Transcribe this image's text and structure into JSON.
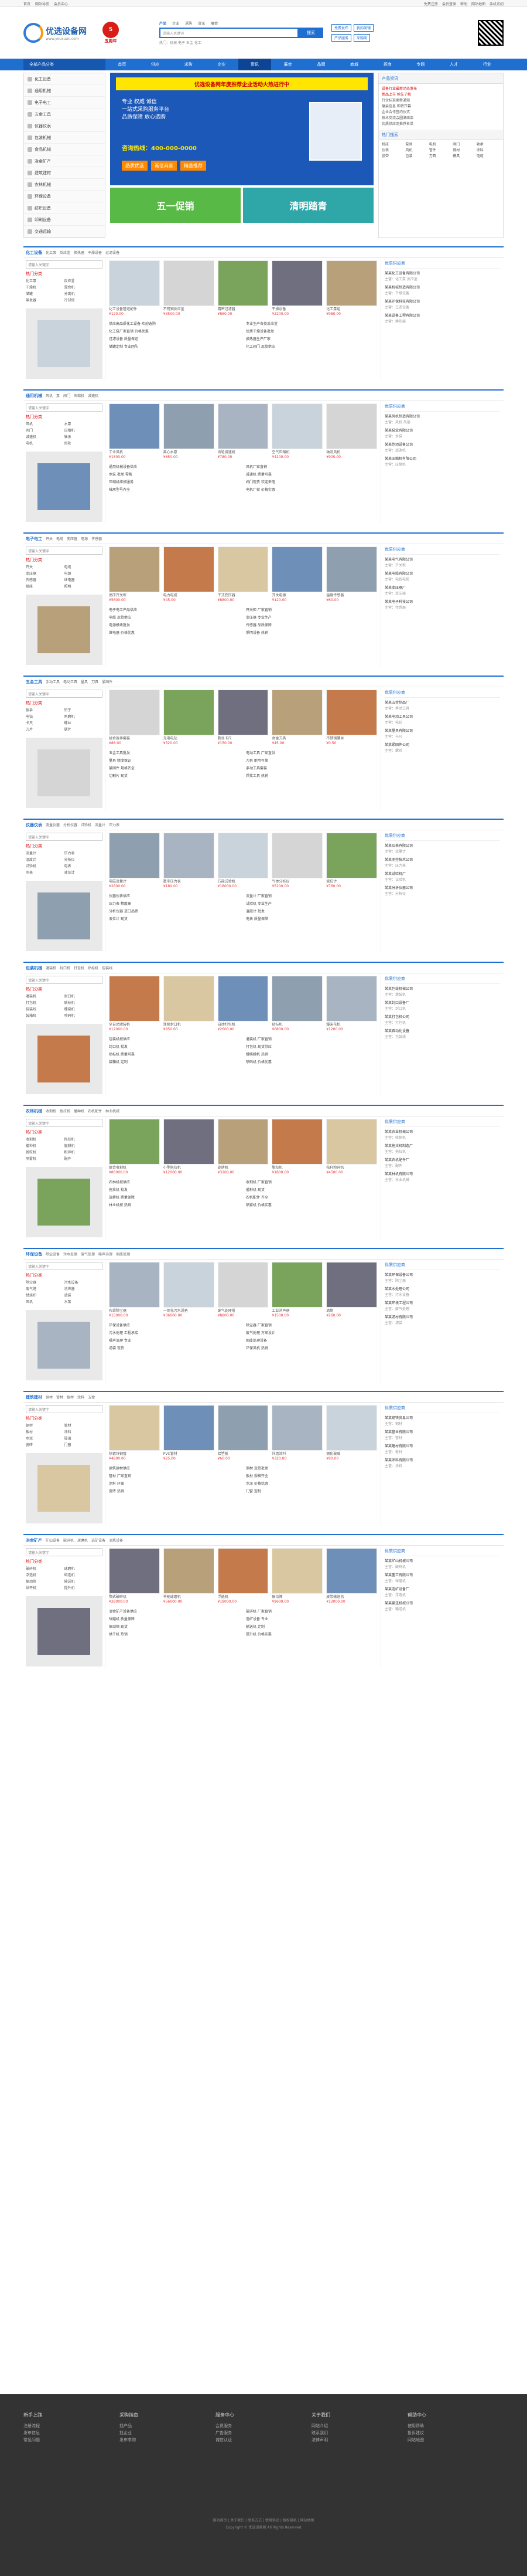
{
  "topbar": {
    "left": [
      "首页",
      "网站导航",
      "会员中心"
    ],
    "right": [
      "免费注册",
      "会员登录",
      "帮助",
      "网站地图",
      "手机访问"
    ]
  },
  "header": {
    "logo_title": "优选设备网",
    "logo_sub": "www.youxuan.com",
    "badge_text": "五周年",
    "search_tabs": [
      "产品",
      "企业",
      "求购",
      "资讯",
      "展会"
    ],
    "search_placeholder": "请输入关键词",
    "search_button": "搜索",
    "hot": "热门：机械 电子 五金 化工",
    "buttons": [
      [
        "免费发布",
        "我的商铺"
      ],
      [
        "产品服务",
        "采购商"
      ]
    ]
  },
  "nav": {
    "category_label": "全部产品分类",
    "items": [
      "首页",
      "供应",
      "求购",
      "企业",
      "资讯",
      "展会",
      "品牌",
      "商城",
      "招商",
      "专题",
      "人才",
      "行业"
    ]
  },
  "categories": [
    "化工设备",
    "通用机械",
    "电子电工",
    "五金工具",
    "仪器仪表",
    "包装机械",
    "食品机械",
    "冶金矿产",
    "建筑建材",
    "农林机械",
    "环保设备",
    "纺织设备",
    "印刷设备",
    "交通运输"
  ],
  "banner": {
    "head": "优选设备网年度推荐企业活动火热进行中",
    "lines": [
      "专业 权威 诚信",
      "一站式采购服务平台",
      "品质保障 放心选购"
    ],
    "phone": "咨询热线：400-000-0000",
    "tags": [
      "品质优选",
      "诚信商家",
      "精品推荐"
    ],
    "sub": [
      "五一促销",
      "清明踏青"
    ]
  },
  "side": {
    "head": "产品资讯",
    "news": [
      "设备行业最新动态发布",
      "新品上市 抢先了解",
      "行业标准更新通知",
      "展会信息 即将开幕",
      "企业合作签约仪式",
      "技术交流会圆满结束",
      "优质供应商推荐名单"
    ],
    "keywords_head": "热门搜索",
    "keywords": [
      "机床",
      "泵阀",
      "电机",
      "阀门",
      "轴承",
      "仪表",
      "风机",
      "管件",
      "钢材",
      "涂料",
      "胶带",
      "包装",
      "刀具",
      "模具",
      "电缆"
    ]
  },
  "sections": [
    {
      "title": "化工设备",
      "subs": [
        "化工泵",
        "反应釜",
        "换热器",
        "干燥设备",
        "过滤设备"
      ],
      "left_select": "请输入关键字",
      "left_title": "热门分类",
      "left_links": [
        "化工泵",
        "反应釜",
        "干燥机",
        "混合机",
        "储罐",
        "分离机",
        "蒸发器",
        "冷却塔"
      ],
      "products": [
        {
          "name": "化工设备管道配件",
          "price": "¥120.00"
        },
        {
          "name": "不锈钢反应釜",
          "price": "¥3500.00"
        },
        {
          "name": "精密过滤器",
          "price": "¥860.00"
        },
        {
          "name": "干燥设备",
          "price": "¥2200.00"
        },
        {
          "name": "化工泵组",
          "price": "¥980.00"
        }
      ],
      "news": [
        "供应高品质化工设备 欢迎选购",
        "专业生产各类反应釜",
        "化工泵厂家直销 价格优惠",
        "优质干燥设备批发",
        "过滤设备 质量保证",
        "换热器生产厂家",
        "储罐定制 专业团队",
        "化工阀门 现货供应"
      ],
      "right_head": "优质供应商",
      "companies": [
        {
          "n": "某某化工设备有限公司",
          "s": "主营：化工泵 反应釜"
        },
        {
          "n": "某某机械制造有限公司",
          "s": "主营：干燥设备"
        },
        {
          "n": "某某环保科技有限公司",
          "s": "主营：过滤设备"
        },
        {
          "n": "某某设备工程有限公司",
          "s": "主营：换热器"
        }
      ]
    },
    {
      "title": "通用机械",
      "subs": [
        "风机",
        "泵",
        "阀门",
        "压缩机",
        "减速机"
      ],
      "left_select": "请输入关键字",
      "left_title": "热门分类",
      "left_links": [
        "风机",
        "水泵",
        "阀门",
        "压缩机",
        "减速机",
        "轴承",
        "电机",
        "齿轮"
      ],
      "products": [
        {
          "name": "工业风机",
          "price": "¥1500.00"
        },
        {
          "name": "离心水泵",
          "price": "¥650.00"
        },
        {
          "name": "齿轮减速机",
          "price": "¥780.00"
        },
        {
          "name": "空气压缩机",
          "price": "¥4200.00"
        },
        {
          "name": "轴流风机",
          "price": "¥900.00"
        }
      ],
      "news": [
        "通用机械设备供应",
        "风机厂家直销",
        "水泵 批发 零售",
        "减速机 质量可靠",
        "压缩机维修服务",
        "阀门现货 欢迎来电",
        "轴承型号齐全",
        "电机厂家 价格实惠"
      ],
      "right_head": "优质供应商",
      "companies": [
        {
          "n": "某某风机制造有限公司",
          "s": "主营：风机 风扇"
        },
        {
          "n": "某某泵业有限公司",
          "s": "主营：水泵"
        },
        {
          "n": "某某传动设备公司",
          "s": "主营：减速机"
        },
        {
          "n": "某某压缩机有限公司",
          "s": "主营：压缩机"
        }
      ]
    },
    {
      "title": "电子电工",
      "subs": [
        "开关",
        "电缆",
        "变压器",
        "电源",
        "传感器"
      ],
      "left_select": "请输入关键字",
      "left_title": "热门分类",
      "left_links": [
        "开关",
        "电缆",
        "变压器",
        "电源",
        "传感器",
        "继电器",
        "插座",
        "照明"
      ],
      "products": [
        {
          "name": "高压开关柜",
          "price": "¥5600.00"
        },
        {
          "name": "电力电缆",
          "price": "¥45.00"
        },
        {
          "name": "干式变压器",
          "price": "¥8800.00"
        },
        {
          "name": "开关电源",
          "price": "¥120.00"
        },
        {
          "name": "温度传感器",
          "price": "¥60.00"
        }
      ],
      "news": [
        "电子电工产品供应",
        "开关柜 厂家直销",
        "电缆 现货供应",
        "变压器 专业生产",
        "电源模块批发",
        "传感器 品质保障",
        "继电器 价格优惠",
        "照明设备 热销"
      ],
      "right_head": "优质供应商",
      "companies": [
        {
          "n": "某某电气有限公司",
          "s": "主营：开关柜"
        },
        {
          "n": "某某电缆有限公司",
          "s": "主营：电线电缆"
        },
        {
          "n": "某某变压器厂",
          "s": "主营：变压器"
        },
        {
          "n": "某某电子科技公司",
          "s": "主营：传感器"
        }
      ]
    },
    {
      "title": "五金工具",
      "subs": [
        "手动工具",
        "电动工具",
        "量具",
        "刀具",
        "紧固件"
      ],
      "left_select": "请输入关键字",
      "left_title": "热门分类",
      "left_links": [
        "扳手",
        "钳子",
        "电钻",
        "角磨机",
        "卡尺",
        "螺丝",
        "刀片",
        "锯片"
      ],
      "products": [
        {
          "name": "组合扳手套装",
          "price": "¥88.00"
        },
        {
          "name": "充电电钻",
          "price": "¥320.00"
        },
        {
          "name": "数显卡尺",
          "price": "¥150.00"
        },
        {
          "name": "合金刀具",
          "price": "¥45.00"
        },
        {
          "name": "不锈钢螺丝",
          "price": "¥0.50"
        }
      ],
      "news": [
        "五金工具批发",
        "电动工具 厂家直供",
        "量具 精度保证",
        "刀具 耐用可靠",
        "紧固件 规格齐全",
        "手动工具套装",
        "切割片 现货",
        "焊接工具 热销"
      ],
      "right_head": "优质供应商",
      "companies": [
        {
          "n": "某某五金制品厂",
          "s": "主营：手动工具"
        },
        {
          "n": "某某电动工具公司",
          "s": "主营：电钻"
        },
        {
          "n": "某某量具有限公司",
          "s": "主营：卡尺"
        },
        {
          "n": "某某紧固件公司",
          "s": "主营：螺丝"
        }
      ]
    },
    {
      "title": "仪器仪表",
      "subs": [
        "测量仪器",
        "分析仪器",
        "试验机",
        "流量计",
        "压力表"
      ],
      "left_select": "请输入关键字",
      "left_title": "热门分类",
      "left_links": [
        "流量计",
        "压力表",
        "温度计",
        "分析仪",
        "试验机",
        "电表",
        "水表",
        "液位计"
      ],
      "products": [
        {
          "name": "电磁流量计",
          "price": "¥2600.00"
        },
        {
          "name": "数字压力表",
          "price": "¥180.00"
        },
        {
          "name": "万能试验机",
          "price": "¥18000.00"
        },
        {
          "name": "气体分析仪",
          "price": "¥5200.00"
        },
        {
          "name": "液位计",
          "price": "¥760.00"
        }
      ],
      "news": [
        "仪器仪表供应",
        "流量计 厂家直销",
        "压力表 精度高",
        "试验机 专业生产",
        "分析仪器 进口品质",
        "温度计 批发",
        "液位计 现货",
        "电表 质量保障"
      ],
      "right_head": "优质供应商",
      "companies": [
        {
          "n": "某某仪表有限公司",
          "s": "主营：流量计"
        },
        {
          "n": "某某测控技术公司",
          "s": "主营：压力表"
        },
        {
          "n": "某某试验机厂",
          "s": "主营：试验机"
        },
        {
          "n": "某某分析仪器公司",
          "s": "主营：分析仪"
        }
      ]
    },
    {
      "title": "包装机械",
      "subs": [
        "灌装机",
        "封口机",
        "打包机",
        "贴标机",
        "包装线"
      ],
      "left_select": "请输入关键字",
      "left_title": "热门分类",
      "left_links": [
        "灌装机",
        "封口机",
        "打包机",
        "贴标机",
        "包装线",
        "缠绕机",
        "装箱机",
        "喷码机"
      ],
      "products": [
        {
          "name": "全自动灌装机",
          "price": "¥12000.00"
        },
        {
          "name": "连续封口机",
          "price": "¥850.00"
        },
        {
          "name": "自动打包机",
          "price": "¥2600.00"
        },
        {
          "name": "贴标机",
          "price": "¥6800.00"
        },
        {
          "name": "爆米花机",
          "price": "¥1200.00"
        }
      ],
      "news": [
        "包装机械供应",
        "灌装机 厂家直销",
        "封口机 批发",
        "打包机 现货供应",
        "贴标机 质量可靠",
        "缠绕膜机 热销",
        "装箱机 定制",
        "喷码机 价格优惠"
      ],
      "right_head": "优质供应商",
      "companies": [
        {
          "n": "某某包装机械公司",
          "s": "主营：灌装机"
        },
        {
          "n": "某某封口设备厂",
          "s": "主营：封口机"
        },
        {
          "n": "某某打包机公司",
          "s": "主营：打包机"
        },
        {
          "n": "某某自动化设备",
          "s": "主营：包装线"
        }
      ]
    },
    {
      "title": "农林机械",
      "subs": [
        "收割机",
        "拖拉机",
        "播种机",
        "农机配件",
        "林业机械"
      ],
      "left_select": "请输入关键字",
      "left_title": "热门分类",
      "left_links": [
        "收割机",
        "拖拉机",
        "播种机",
        "旋耕机",
        "脱粒机",
        "粉碎机",
        "喷雾机",
        "配件"
      ],
      "products": [
        {
          "name": "联合收割机",
          "price": "¥86000.00"
        },
        {
          "name": "小型拖拉机",
          "price": "¥12000.00"
        },
        {
          "name": "旋耕机",
          "price": "¥3200.00"
        },
        {
          "name": "脱粒机",
          "price": "¥1800.00"
        },
        {
          "name": "秸秆粉碎机",
          "price": "¥4500.00"
        }
      ],
      "news": [
        "农林机械供应",
        "收割机 厂家直销",
        "拖拉机 批发",
        "播种机 现货",
        "旋耕机 质量保障",
        "农机配件 齐全",
        "林业机械 热销",
        "喷雾机 价格实惠"
      ],
      "right_head": "优质供应商",
      "companies": [
        {
          "n": "某某农业机械公司",
          "s": "主营：收割机"
        },
        {
          "n": "某某拖拉机制造厂",
          "s": "主营：拖拉机"
        },
        {
          "n": "某某农机配件厂",
          "s": "主营：配件"
        },
        {
          "n": "某某林机有限公司",
          "s": "主营：林业机械"
        }
      ]
    },
    {
      "title": "环保设备",
      "subs": [
        "除尘设备",
        "污水处理",
        "废气处理",
        "噪声治理",
        "固废处理"
      ],
      "left_select": "请输入关键字",
      "left_title": "热门分类",
      "left_links": [
        "除尘器",
        "污水设备",
        "废气塔",
        "消声器",
        "焚烧炉",
        "滤袋",
        "风机",
        "水泵"
      ],
      "products": [
        {
          "name": "布袋除尘器",
          "price": "¥15000.00"
        },
        {
          "name": "一体化污水设备",
          "price": "¥36000.00"
        },
        {
          "name": "废气处理塔",
          "price": "¥8800.00"
        },
        {
          "name": "工业消声器",
          "price": "¥1500.00"
        },
        {
          "name": "滤筒",
          "price": "¥260.00"
        }
      ],
      "news": [
        "环保设备供应",
        "除尘器 厂家直销",
        "污水处理 工程承接",
        "废气处理 方案设计",
        "噪声治理 专业",
        "固废处理设备",
        "滤袋 现货",
        "环保风机 热销"
      ],
      "right_head": "优质供应商",
      "companies": [
        {
          "n": "某某环保设备公司",
          "s": "主营：除尘器"
        },
        {
          "n": "某某水处理公司",
          "s": "主营：污水设备"
        },
        {
          "n": "某某环境工程公司",
          "s": "主营：废气处理"
        },
        {
          "n": "某某滤材有限公司",
          "s": "主营：滤袋"
        }
      ]
    },
    {
      "title": "建筑建材",
      "subs": [
        "钢材",
        "管材",
        "板材",
        "涂料",
        "五金"
      ],
      "left_select": "请输入关键字",
      "left_title": "热门分类",
      "left_links": [
        "钢材",
        "管材",
        "板材",
        "涂料",
        "水泥",
        "玻璃",
        "瓷砖",
        "门窗"
      ],
      "products": [
        {
          "name": "热镀锌钢管",
          "price": "¥4800.00"
        },
        {
          "name": "PVC管材",
          "price": "¥25.00"
        },
        {
          "name": "铝塑板",
          "price": "¥60.00"
        },
        {
          "name": "外墙涂料",
          "price": "¥320.00"
        },
        {
          "name": "钢化玻璃",
          "price": "¥90.00"
        }
      ],
      "news": [
        "建筑建材供应",
        "钢材 现货批发",
        "管材 厂家直销",
        "板材 规格齐全",
        "涂料 环保",
        "水泥 价格优惠",
        "瓷砖 热销",
        "门窗 定制"
      ],
      "right_head": "优质供应商",
      "companies": [
        {
          "n": "某某钢铁贸易公司",
          "s": "主营：钢材"
        },
        {
          "n": "某某管业有限公司",
          "s": "主营：管材"
        },
        {
          "n": "某某建材有限公司",
          "s": "主营：板材"
        },
        {
          "n": "某某涂料有限公司",
          "s": "主营：涂料"
        }
      ]
    },
    {
      "title": "冶金矿产",
      "subs": [
        "矿山设备",
        "破碎机",
        "球磨机",
        "选矿设备",
        "冶炼设备"
      ],
      "left_select": "请输入关键字",
      "left_title": "热门分类",
      "left_links": [
        "破碎机",
        "球磨机",
        "浮选机",
        "磁选机",
        "振动筛",
        "输送机",
        "烘干机",
        "提升机"
      ],
      "products": [
        {
          "name": "颚式破碎机",
          "price": "¥28000.00"
        },
        {
          "name": "节能球磨机",
          "price": "¥56000.00"
        },
        {
          "name": "浮选机",
          "price": "¥18000.00"
        },
        {
          "name": "振动筛",
          "price": "¥9600.00"
        },
        {
          "name": "皮带输送机",
          "price": "¥12000.00"
        }
      ],
      "news": [
        "冶金矿产设备供应",
        "破碎机 厂家直销",
        "球磨机 质量保障",
        "选矿设备 专业",
        "振动筛 现货",
        "输送机 定制",
        "烘干机 热销",
        "提升机 价格实惠"
      ],
      "right_head": "优质供应商",
      "companies": [
        {
          "n": "某某矿山机械公司",
          "s": "主营：破碎机"
        },
        {
          "n": "某某重工有限公司",
          "s": "主营：球磨机"
        },
        {
          "n": "某某选矿设备厂",
          "s": "主营：浮选机"
        },
        {
          "n": "某某输送机械公司",
          "s": "主营：输送机"
        }
      ]
    }
  ],
  "footer": {
    "cols": [
      {
        "h": "新手上路",
        "items": [
          "注册流程",
          "发布信息",
          "常见问题"
        ]
      },
      {
        "h": "采购指南",
        "items": [
          "找产品",
          "找企业",
          "发布求购"
        ]
      },
      {
        "h": "服务中心",
        "items": [
          "会员服务",
          "广告服务",
          "诚信认证"
        ]
      },
      {
        "h": "关于我们",
        "items": [
          "网站介绍",
          "联系我们",
          "法律声明"
        ]
      },
      {
        "h": "帮助中心",
        "items": [
          "使用帮助",
          "投诉建议",
          "网站地图"
        ]
      }
    ],
    "bottom": [
      "网站首页 | 关于我们 | 联系方式 | 使用协议 | 版权隐私 | 网站地图",
      "Copyright © 优选设备网 All Rights Reserved"
    ]
  },
  "colors": {
    "primary": "#1f6fd1",
    "price": "#e33"
  }
}
